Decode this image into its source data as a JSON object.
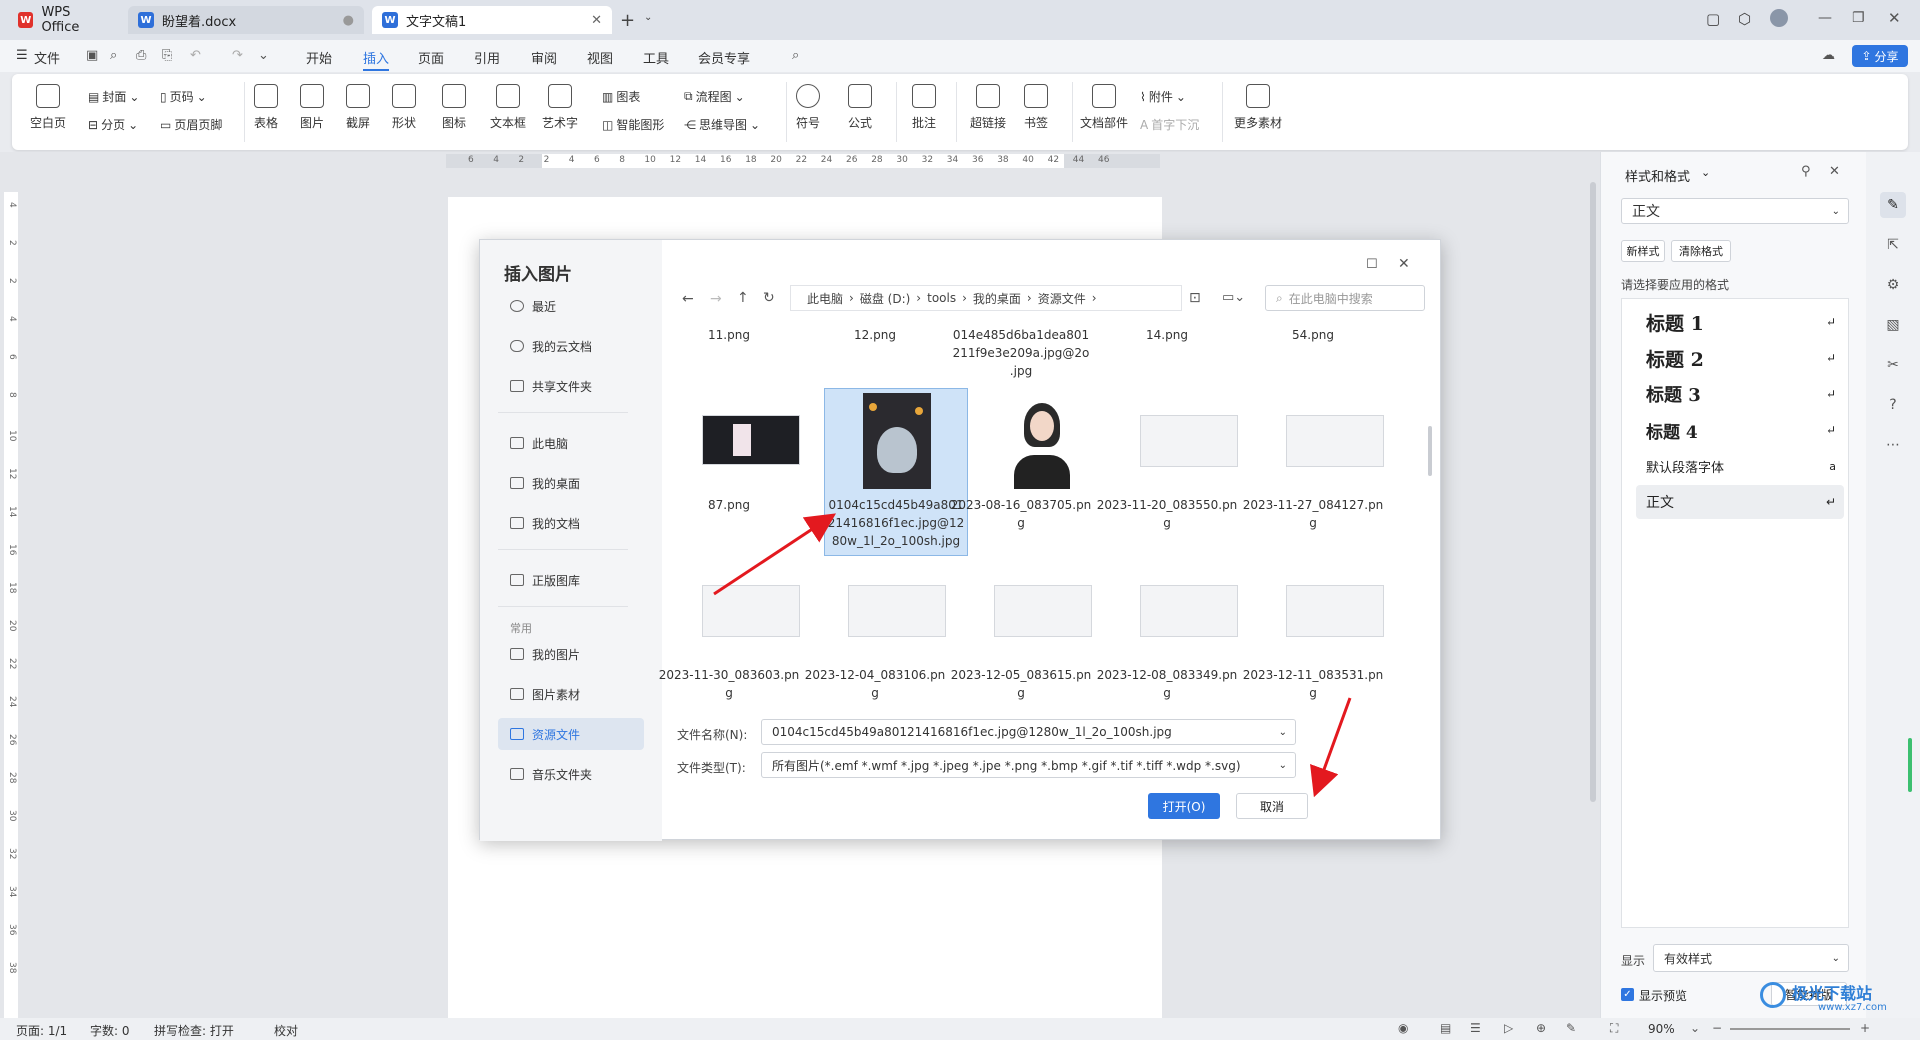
{
  "tabs": [
    {
      "label": "WPS Office",
      "icon": "wps-logo"
    },
    {
      "label": "盼望着.docx",
      "icon": "word-doc-icon"
    },
    {
      "label": "文字文稿1",
      "icon": "word-doc-icon"
    }
  ],
  "menu": {
    "file": "文件",
    "items": [
      "开始",
      "插入",
      "页面",
      "引用",
      "审阅",
      "视图",
      "工具",
      "会员专享"
    ],
    "active": "插入",
    "share": "分享"
  },
  "ribbon": {
    "small_top": [
      "封面",
      "页码",
      "图表",
      "流程图",
      "附件"
    ],
    "small_bottom": [
      "分页",
      "页眉页脚",
      "智能图形",
      "思维导图",
      "首字下沉"
    ],
    "big": [
      "空白页",
      "表格",
      "图片",
      "截屏",
      "形状",
      "图标",
      "文本框",
      "艺术字",
      "符号",
      "公式",
      "批注",
      "超链接",
      "书签",
      "文档部件",
      "更多素材"
    ]
  },
  "ruler_labels": [
    "6",
    "4",
    "2",
    "2",
    "4",
    "6",
    "8",
    "10",
    "12",
    "14",
    "16",
    "18",
    "20",
    "22",
    "24",
    "26",
    "28",
    "30",
    "32",
    "34",
    "36",
    "38",
    "40",
    "42",
    "44",
    "46"
  ],
  "vruler_labels": [
    "4",
    "2",
    "2",
    "4",
    "6",
    "8",
    "10",
    "12",
    "14",
    "16",
    "18",
    "20",
    "22",
    "24",
    "26",
    "28",
    "30",
    "32",
    "34",
    "36",
    "38"
  ],
  "dialog": {
    "title": "插入图片",
    "nav_top": [
      "最近",
      "我的云文档",
      "共享文件夹"
    ],
    "nav_mid": [
      "此电脑",
      "我的桌面",
      "我的文档"
    ],
    "nav_gallery": "正版图库",
    "common_label": "常用",
    "nav_common": [
      "我的图片",
      "图片素材",
      "资源文件",
      "音乐文件夹"
    ],
    "active_nav": "资源文件",
    "breadcrumb": [
      "此电脑",
      "磁盘 (D:)",
      "tools",
      "我的桌面",
      "资源文件"
    ],
    "search_placeholder": "在此电脑中搜索",
    "row0": [
      "11.png",
      "12.png",
      "014e485d6ba1dea801\n211f9e3e209a.jpg@2o\n.jpg",
      "14.png",
      "54.png"
    ],
    "row1": [
      "87.png",
      "0104c15cd45b49a801\n21416816f1ec.jpg@12\n80w_1l_2o_100sh.jpg",
      "2023-08-16_083705.pn\ng",
      "2023-11-20_083550.pn\ng",
      "2023-11-27_084127.pn\ng"
    ],
    "row2": [
      "2023-11-30_083603.pn\ng",
      "2023-12-04_083106.pn\ng",
      "2023-12-05_083615.pn\ng",
      "2023-12-08_083349.pn\ng",
      "2023-12-11_083531.pn\ng"
    ],
    "filename_label": "文件名称(N):",
    "filename_value": "0104c15cd45b49a80121416816f1ec.jpg@1280w_1l_2o_100sh.jpg",
    "filetype_label": "文件类型(T):",
    "filetype_value": "所有图片(*.emf *.wmf *.jpg *.jpeg *.jpe *.png *.bmp *.gif *.tif *.tiff *.wdp *.svg)",
    "open": "打开(O)",
    "cancel": "取消"
  },
  "panel": {
    "title": "样式和格式",
    "current_style": "正文",
    "new_style": "新样式",
    "clear_format": "清除格式",
    "hint": "请选择要应用的格式",
    "styles": [
      "标题  1",
      "标题  2",
      "标题  3",
      "标题  4",
      "默认段落字体",
      "正文"
    ],
    "show_label": "显示",
    "show_value": "有效样式",
    "preview_label": "显示预览",
    "smart_btn": "智能排版"
  },
  "status": {
    "page": "页面: 1/1",
    "words": "字数: 0",
    "spell": "拼写检查: 打开",
    "proof": "校对",
    "zoom": "90%"
  },
  "watermark": "极光下载站",
  "watermark_url": "www.xz7.com",
  "colors": {
    "accent": "#2f76e0",
    "arrow": "#e3191f",
    "wps_red": "#e0312b",
    "word_blue": "#2e6fd9"
  }
}
